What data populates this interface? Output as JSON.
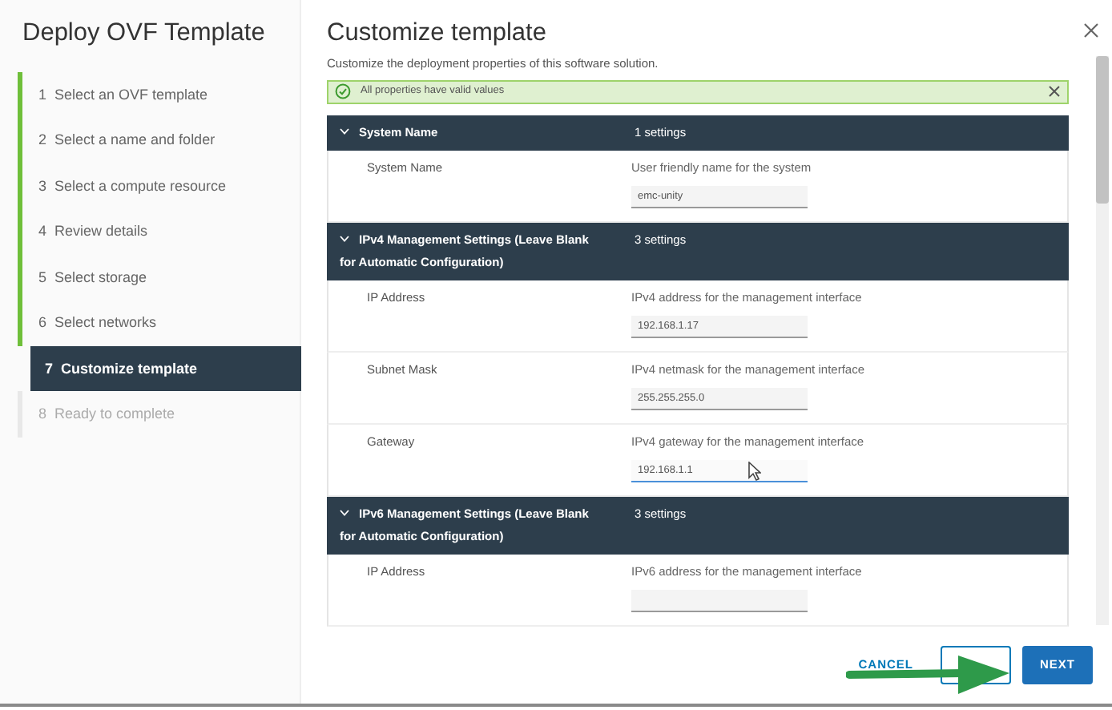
{
  "wizard": {
    "title": "Deploy OVF Template",
    "steps": [
      {
        "number": "1",
        "label": "Select an OVF template",
        "completed": true,
        "disabled": false,
        "selected": false
      },
      {
        "number": "2",
        "label": "Select a name and folder",
        "completed": true,
        "disabled": false,
        "selected": false
      },
      {
        "number": "3",
        "label": "Select a compute resource",
        "completed": true,
        "disabled": false,
        "selected": false
      },
      {
        "number": "4",
        "label": "Review details",
        "completed": true,
        "disabled": false,
        "selected": false
      },
      {
        "number": "5",
        "label": "Select storage",
        "completed": true,
        "disabled": false,
        "selected": false
      },
      {
        "number": "6",
        "label": "Select networks",
        "completed": true,
        "disabled": false,
        "selected": false
      },
      {
        "number": "7",
        "label": "Customize template",
        "completed": false,
        "disabled": false,
        "selected": true
      },
      {
        "number": "8",
        "label": "Ready to complete",
        "completed": false,
        "disabled": true,
        "selected": false
      }
    ]
  },
  "page": {
    "title": "Customize template",
    "subtitle": "Customize the deployment properties of this software solution.",
    "alert": {
      "text": "All properties have valid values"
    },
    "sections": [
      {
        "title": "System Name",
        "count": "1 settings",
        "expanded": true,
        "properties": [
          {
            "label": "System Name",
            "description": "User friendly name for the system",
            "value": "emc-unity",
            "focused": false
          }
        ]
      },
      {
        "title": "IPv4 Management Settings (Leave Blank for Automatic Configuration)",
        "count": "3 settings",
        "expanded": true,
        "properties": [
          {
            "label": "IP Address",
            "description": "IPv4 address for the management interface",
            "value": "192.168.1.17",
            "focused": false
          },
          {
            "label": "Subnet Mask",
            "description": "IPv4 netmask for the management interface",
            "value": "255.255.255.0",
            "focused": false
          },
          {
            "label": "Gateway",
            "description": "IPv4 gateway for the management interface",
            "value": "192.168.1.1",
            "focused": true
          }
        ]
      },
      {
        "title": "IPv6 Management Settings (Leave Blank for Automatic Configuration)",
        "count": "3 settings",
        "expanded": true,
        "properties": [
          {
            "label": "IP Address",
            "description": "IPv6 address for the management interface",
            "focused": false
          }
        ]
      }
    ]
  },
  "buttons": [
    {
      "kind": "cancel",
      "label": "CANCEL"
    },
    {
      "kind": "back"
    },
    {
      "kind": "next",
      "label": "NEXT"
    }
  ]
}
